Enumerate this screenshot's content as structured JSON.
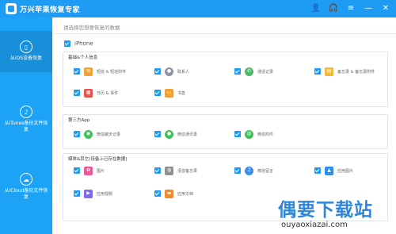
{
  "app": {
    "title": "万兴苹果恢复专家"
  },
  "window_controls": [
    {
      "name": "user-icon",
      "glyph": "👤"
    },
    {
      "name": "headset-icon",
      "glyph": "🎧"
    },
    {
      "name": "menu-icon",
      "glyph": "≡"
    },
    {
      "name": "minimize-icon",
      "glyph": "—"
    },
    {
      "name": "close-icon",
      "glyph": "✕"
    }
  ],
  "sidebar": {
    "items": [
      {
        "label": "从iOS设备恢复",
        "icon": "phone-icon",
        "glyph": "▯",
        "active": true
      },
      {
        "label": "从iTunes备份文件恢复",
        "icon": "music-note-icon",
        "glyph": "♪",
        "active": false
      },
      {
        "label": "从iCloud备份文件恢复",
        "icon": "cloud-icon",
        "glyph": "☁",
        "active": false
      }
    ]
  },
  "main": {
    "instruction": "请选择您想要恢复的数据",
    "device_label": "iPhone",
    "sections": [
      {
        "title": "基础&个人信息",
        "items": [
          {
            "label": "短信 & 短信附件",
            "color": "#f0a63c",
            "icon": "message-icon",
            "glyph": "✉"
          },
          {
            "label": "联系人",
            "color": "#8a96a6",
            "icon": "contact-icon",
            "glyph": "●"
          },
          {
            "label": "通话记录",
            "color": "#4cb86a",
            "icon": "phone-call-icon",
            "glyph": "✆"
          },
          {
            "label": "备忘录 & 备忘录附件",
            "color": "#f2b93f",
            "icon": "notes-icon",
            "glyph": "▤"
          },
          {
            "label": "日历 & 事件",
            "color": "#e8554e",
            "icon": "calendar-icon",
            "glyph": "▦"
          },
          {
            "label": "书签",
            "color": "#f0a03a",
            "icon": "bookmark-icon",
            "glyph": "▭"
          }
        ]
      },
      {
        "title": "第三方App",
        "items": [
          {
            "label": "微信聊天记录",
            "color": "#3fbf5a",
            "icon": "wechat-icon",
            "glyph": "◉"
          },
          {
            "label": "微信通讯录",
            "color": "#3fbf5a",
            "icon": "wechat-contacts-icon",
            "glyph": "●"
          },
          {
            "label": "微信附件",
            "color": "#3fbf5a",
            "icon": "wechat-attachment-icon",
            "glyph": "@"
          }
        ]
      },
      {
        "title": "媒体&其它(设备上已存在数据)",
        "items": [
          {
            "label": "图片",
            "color": "#e85a9a",
            "icon": "photo-icon",
            "glyph": "✿"
          },
          {
            "label": "语音备忘录",
            "color": "#8e8e93",
            "icon": "voice-memo-icon",
            "glyph": "◍"
          },
          {
            "label": "微信留言",
            "color": "#3a8ee6",
            "icon": "voicemail-icon",
            "glyph": "♫"
          },
          {
            "label": "应用图片",
            "color": "#2f8fe8",
            "icon": "app-photo-icon",
            "glyph": "▲"
          },
          {
            "label": "应用视频",
            "color": "#7d6cf0",
            "icon": "app-video-icon",
            "glyph": "▶"
          },
          {
            "label": "应用文档",
            "color": "#f08c2e",
            "icon": "app-document-icon",
            "glyph": "▬"
          }
        ]
      }
    ]
  },
  "watermark": {
    "text": "偶要下载站",
    "url": "ouyaoxiazai.com"
  }
}
